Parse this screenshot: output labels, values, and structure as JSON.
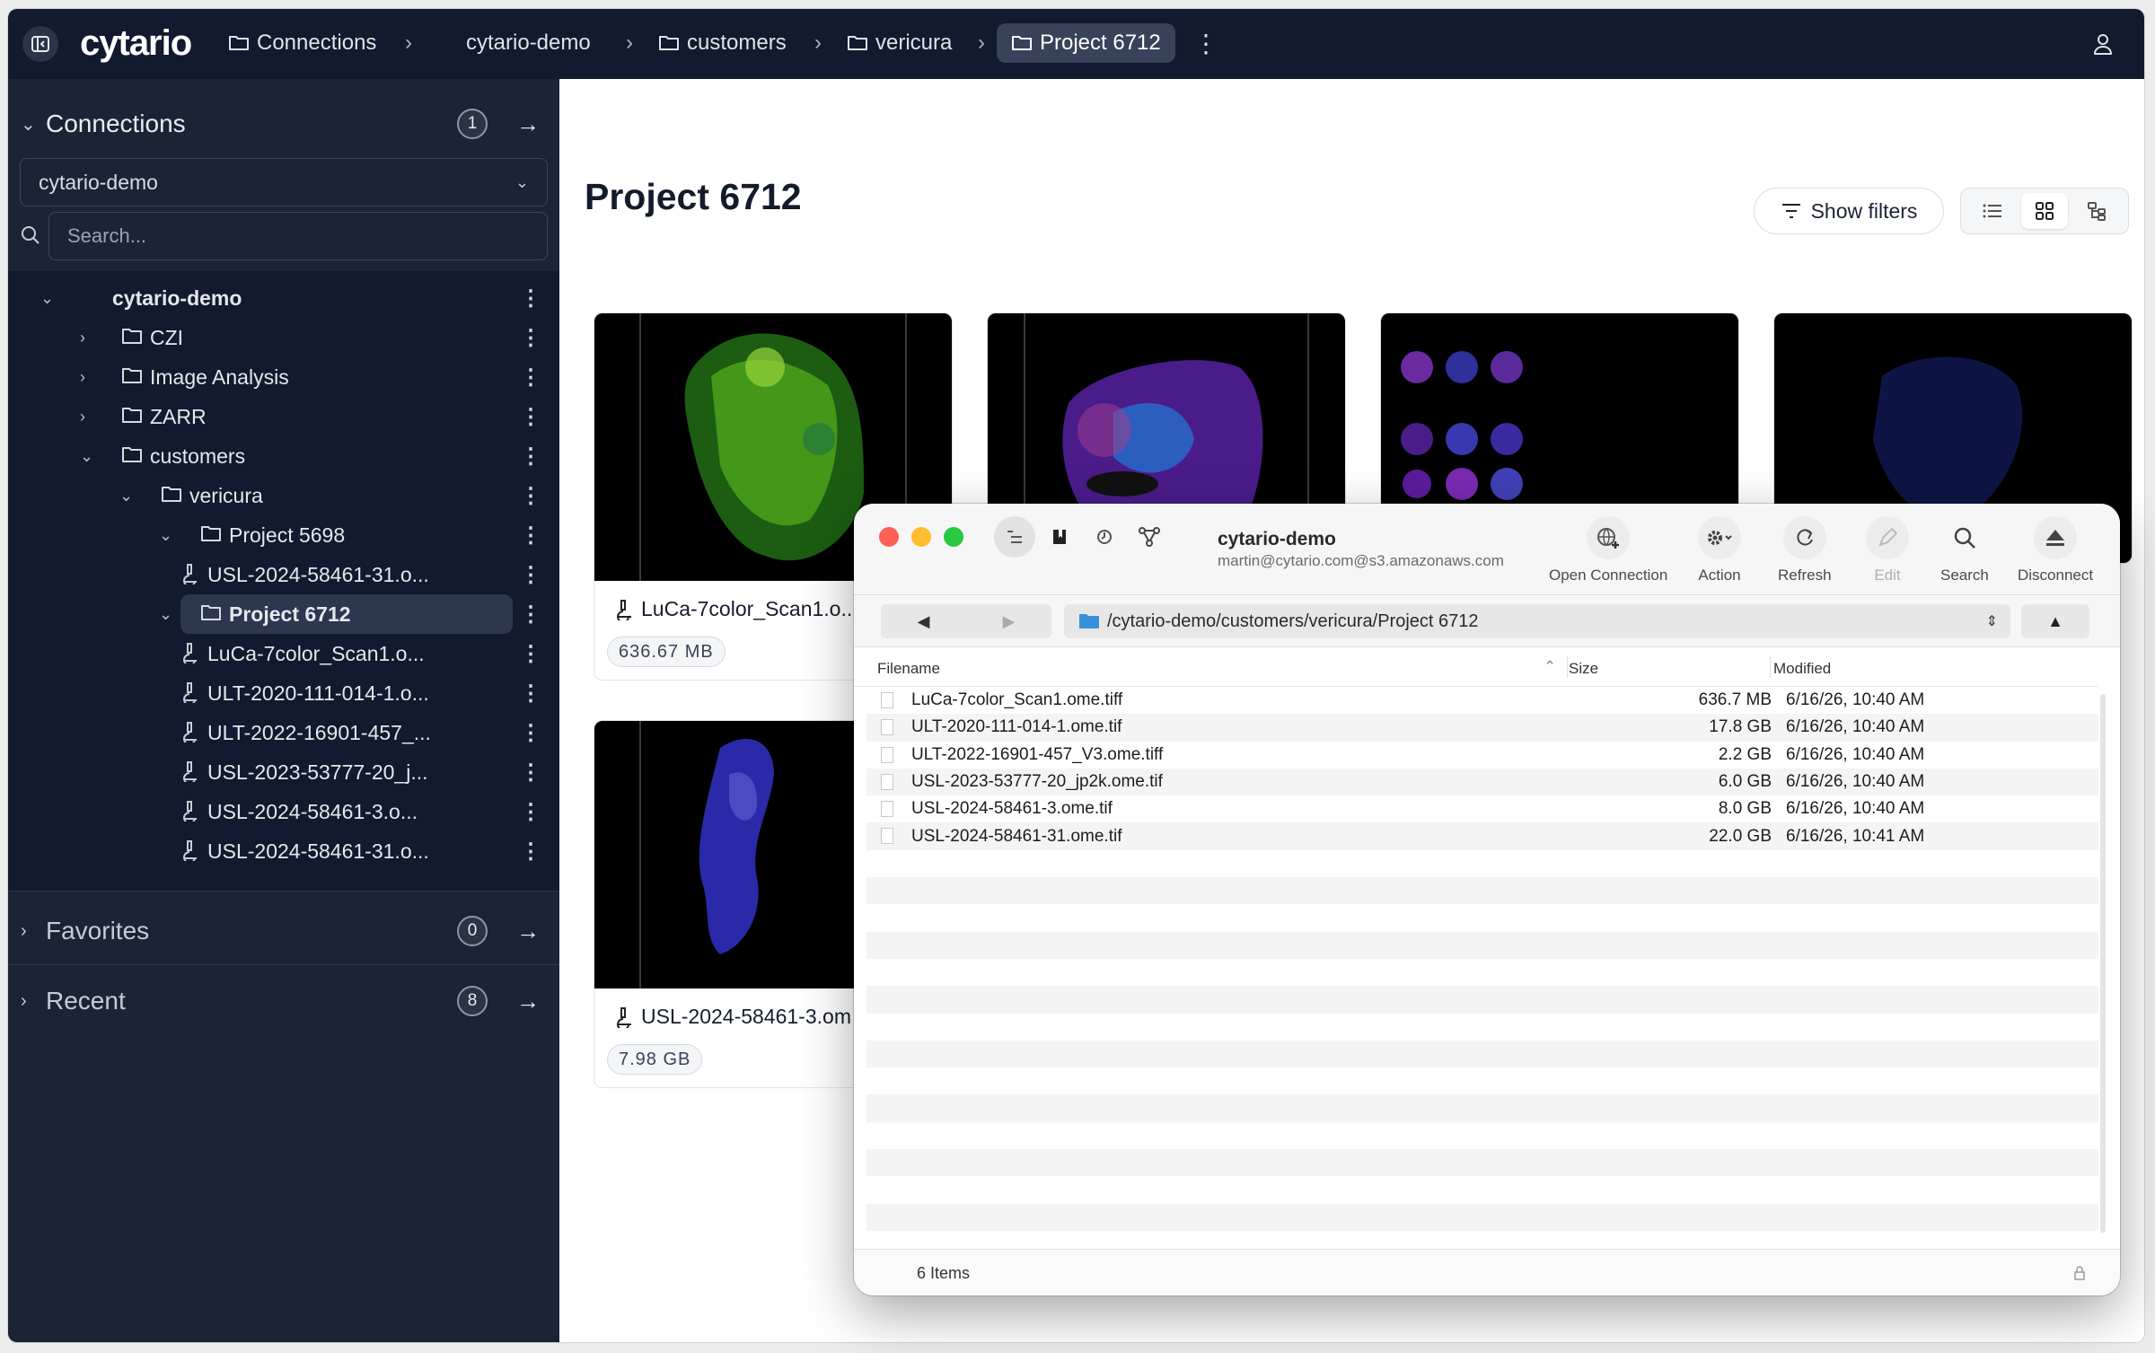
{
  "topbar": {
    "brand": "cytario",
    "breadcrumbs": [
      "Connections",
      "cytario-demo",
      "customers",
      "vericura",
      "Project 6712"
    ]
  },
  "sidebar": {
    "connections": {
      "title": "Connections",
      "count": "1"
    },
    "connection_select": "cytario-demo",
    "search_placeholder": "Search...",
    "tree": [
      {
        "label": "cytario-demo",
        "type": "root"
      },
      {
        "label": "CZI",
        "type": "folder"
      },
      {
        "label": "Image Analysis",
        "type": "folder"
      },
      {
        "label": "ZARR",
        "type": "folder"
      },
      {
        "label": "customers",
        "type": "folder"
      },
      {
        "label": "vericura",
        "type": "folder"
      },
      {
        "label": "Project 5698",
        "type": "folder"
      },
      {
        "label": "USL-2024-58461-31.o...",
        "type": "file"
      },
      {
        "label": "Project 6712",
        "type": "folder"
      },
      {
        "label": "LuCa-7color_Scan1.o...",
        "type": "file"
      },
      {
        "label": "ULT-2020-111-014-1.o...",
        "type": "file"
      },
      {
        "label": "ULT-2022-16901-457_...",
        "type": "file"
      },
      {
        "label": "USL-2023-53777-20_j...",
        "type": "file"
      },
      {
        "label": "USL-2024-58461-3.o...",
        "type": "file"
      },
      {
        "label": "USL-2024-58461-31.o...",
        "type": "file"
      }
    ],
    "favorites": {
      "title": "Favorites",
      "count": "0"
    },
    "recent": {
      "title": "Recent",
      "count": "8"
    }
  },
  "main": {
    "title": "Project 6712",
    "show_filters": "Show filters",
    "cards": [
      {
        "name": "LuCa-7color_Scan1.o...",
        "size": "636.67 MB"
      },
      {
        "name": "",
        "size": ""
      },
      {
        "name": "",
        "size": ""
      },
      {
        "name": "",
        "size": ""
      },
      {
        "name": "USL-2024-58461-3.om",
        "size": "7.98 GB"
      }
    ]
  },
  "window": {
    "server_name": "cytario-demo",
    "server_sub": "martin@cytario.com@s3.amazonaws.com",
    "toolbar": [
      "Open Connection",
      "Action",
      "Refresh",
      "Edit",
      "Search",
      "Disconnect"
    ],
    "path": "/cytario-demo/customers/vericura/Project 6712",
    "columns": {
      "filename": "Filename",
      "size": "Size",
      "modified": "Modified"
    },
    "files": [
      {
        "name": "LuCa-7color_Scan1.ome.tiff",
        "size": "636.7 MB",
        "modified": "6/16/26, 10:40 AM"
      },
      {
        "name": "ULT-2020-111-014-1.ome.tif",
        "size": "17.8 GB",
        "modified": "6/16/26, 10:40 AM"
      },
      {
        "name": "ULT-2022-16901-457_V3.ome.tiff",
        "size": "2.2 GB",
        "modified": "6/16/26, 10:40 AM"
      },
      {
        "name": "USL-2023-53777-20_jp2k.ome.tif",
        "size": "6.0 GB",
        "modified": "6/16/26, 10:40 AM"
      },
      {
        "name": "USL-2024-58461-3.ome.tif",
        "size": "8.0 GB",
        "modified": "6/16/26, 10:40 AM"
      },
      {
        "name": "USL-2024-58461-31.ome.tif",
        "size": "22.0 GB",
        "modified": "6/16/26, 10:41 AM"
      }
    ],
    "item_count": "6 Items"
  }
}
